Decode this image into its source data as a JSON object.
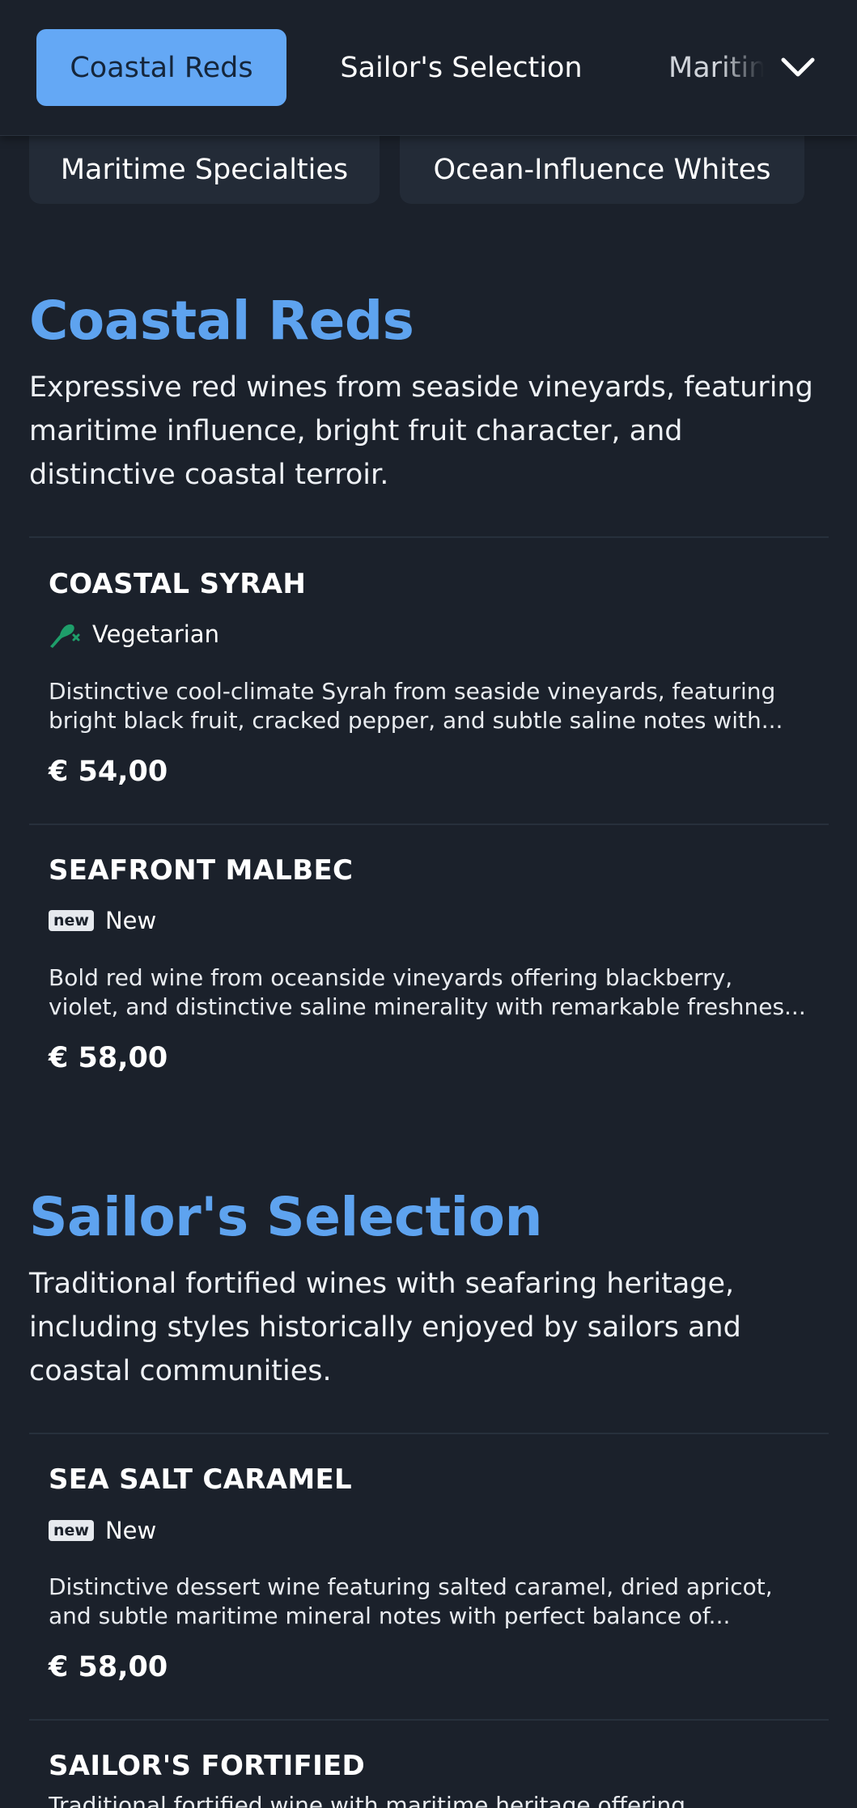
{
  "nav": {
    "tabs": [
      {
        "label": "Coastal Reds",
        "active": true
      },
      {
        "label": "Sailor's Selection",
        "active": false
      },
      {
        "label": "Maritime Specialties",
        "active": false
      }
    ],
    "more_icon": "chevron-down-icon"
  },
  "chips": [
    {
      "label": "Maritime Specialties"
    },
    {
      "label": "Ocean-Influence Whites"
    }
  ],
  "sections": [
    {
      "title": "Coastal Reds",
      "description": "Expressive red wines from seaside vineyards, featuring maritime influence, bright fruit character, and distinctive coastal terroir.",
      "items": [
        {
          "name": "COASTAL SYRAH",
          "tag_icon": "vegetarian-icon",
          "tag_label": "Vegetarian",
          "description_lines": [
            "Distinctive cool-climate Syrah from seaside vineyards, featuring",
            "bright black fruit, cracked pepper, and subtle saline notes with..."
          ],
          "price": "€ 54,00"
        },
        {
          "name": "SEAFRONT MALBEC",
          "tag_badge": "new",
          "tag_label": "New",
          "description_lines": [
            "Bold red wine from oceanside vineyards offering blackberry,",
            "violet, and distinctive saline minerality with remarkable freshnes..."
          ],
          "price": "€ 58,00"
        }
      ]
    },
    {
      "title": "Sailor's Selection",
      "description": "Traditional fortified wines with seafaring heritage, including styles historically enjoyed by sailors and coastal communities.",
      "items": [
        {
          "name": "SEA SALT CARAMEL",
          "tag_badge": "new",
          "tag_label": "New",
          "description_lines": [
            "Distinctive dessert wine featuring salted caramel, dried apricot,",
            "and subtle maritime mineral notes with perfect balance of..."
          ],
          "price": "€ 58,00"
        },
        {
          "name": "SAILOR'S FORTIFIED",
          "description_lines": [
            "Traditional fortified wine with maritime heritage offering"
          ]
        }
      ]
    }
  ],
  "colors": {
    "background": "#1b212b",
    "accent": "#64a8f5",
    "section_title": "#5ea3ef",
    "chip_bg": "#232b37",
    "vegetarian_green": "#1e9e6a"
  }
}
